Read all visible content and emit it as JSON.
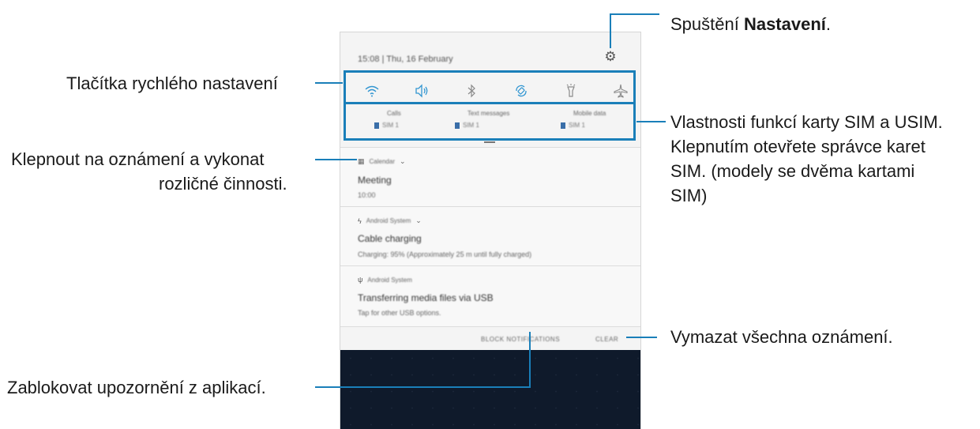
{
  "callouts": {
    "settings_pre": "Spuštění ",
    "settings_bold": "Nastavení",
    "settings_post": ".",
    "quick_settings": "Tlačítka rychlého nastavení",
    "sim_line1": "Vlastnosti funkcí karty SIM a USIM.",
    "sim_line2": "Klepnutím otevřete správce karet",
    "sim_line3": "SIM. (modely se dvěma kartami",
    "sim_line4": "SIM)",
    "tap_line1": "Klepnout na oznámení a vykonat",
    "tap_line2": "rozličné činnosti.",
    "clear_all": "Vymazat všechna oznámení.",
    "block": "Zablokovat upozornění z aplikací."
  },
  "panel": {
    "datetime": "15:08 | Thu, 16 February",
    "quick_icons": [
      "wifi-icon",
      "sound-icon",
      "bluetooth-icon",
      "auto-rotate-icon",
      "flashlight-icon",
      "airplane-icon"
    ],
    "sim_cards": [
      {
        "name": "Calls",
        "sim": "SIM 1"
      },
      {
        "name": "Text messages",
        "sim": "SIM 1"
      },
      {
        "name": "Mobile data",
        "sim": "SIM 1"
      }
    ],
    "notifications": [
      {
        "app": "Calendar",
        "title": "Meeting",
        "body": "10:00"
      },
      {
        "app": "Android System",
        "title": "Cable charging",
        "body": "Charging: 95% (Approximately 25 m until fully charged)"
      },
      {
        "app": "Android System",
        "title": "Transferring media files via USB",
        "body": "Tap for other USB options."
      }
    ],
    "block_button": "BLOCK NOTIFICATIONS",
    "clear_button": "CLEAR"
  },
  "colors": {
    "accent": "#1a7fb9",
    "icon": "#3296d1",
    "wallpaper": "#0f1a2b"
  }
}
